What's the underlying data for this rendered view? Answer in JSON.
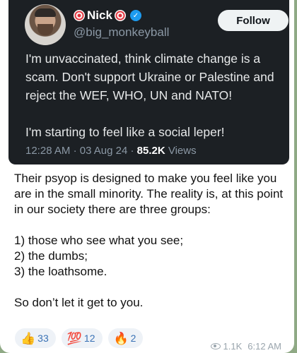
{
  "tweet": {
    "display_name": "Nick",
    "handle": "@big_monkeyball",
    "follow_label": "Follow",
    "paragraphs": [
      "I'm unvaccinated, think climate change is a scam. Don't support Ukraine or Palestine and reject the WEF, WHO, UN and NATO!",
      "I'm starting to feel like a social leper!"
    ],
    "time": "12:28 AM",
    "date": "03 Aug 24",
    "views_count": "85.2K",
    "views_label": "Views",
    "separator": "·"
  },
  "message": {
    "paragraphs": [
      "Their psyop is designed to make you feel like you are in the small minority. The reality is, at this point in our society there are three groups:",
      "1) those who see what you see;\n2) the dumbs;\n3) the loathsome.",
      "So don’t let it get to you."
    ],
    "views": "1.1K",
    "time": "6:12 AM"
  },
  "reactions": [
    {
      "emoji": "👍",
      "count": "33"
    },
    {
      "emoji": "💯",
      "count": "12"
    },
    {
      "emoji": "🔥",
      "count": "2"
    }
  ],
  "colors": {
    "tweet_bg": "#1c2024",
    "verified": "#1d9bf0",
    "reaction_text": "#3a72b5",
    "wallpaper": "#8fa985"
  }
}
